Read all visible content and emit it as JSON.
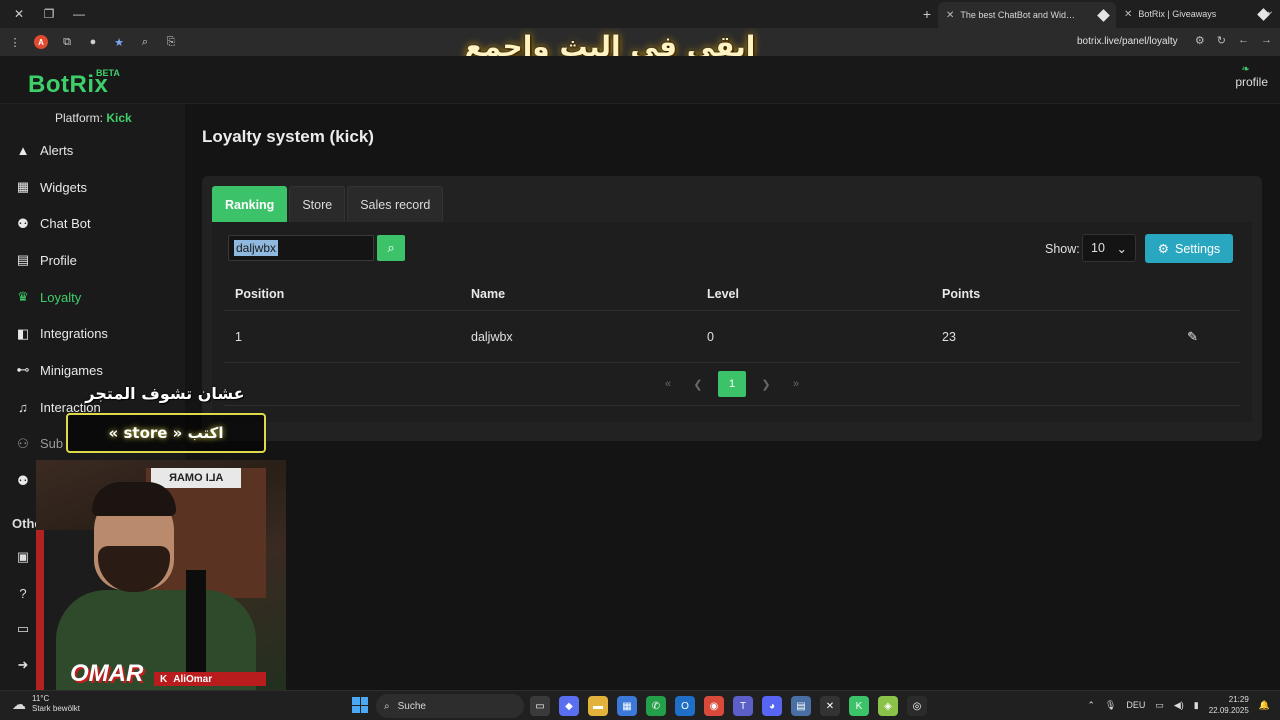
{
  "browser": {
    "tabs": [
      {
        "title": "The best ChatBot and Widgets",
        "active": true
      },
      {
        "title": "BotRix | Giveaways",
        "active": false
      }
    ],
    "url": "botrix.live/panel/loyalty"
  },
  "overlay": {
    "headline": "ابقى في البث واجمع النقاط!",
    "promo_line1": "عشان تشوف المتجر",
    "promo_line2": "اكتب « store »",
    "streamer_name": "OMAR",
    "streamer_tag": "AliOmar",
    "poster_text": "ALI OMAR"
  },
  "app": {
    "logo": "BotRix",
    "beta": "BETA",
    "profile_label": "profile",
    "platform_label": "Platform:",
    "platform_value": "Kick"
  },
  "sidebar": {
    "items": [
      {
        "label": "Alerts",
        "icon": "warning-icon"
      },
      {
        "label": "Widgets",
        "icon": "grid-icon"
      },
      {
        "label": "Chat Bot",
        "icon": "robot-icon"
      },
      {
        "label": "Profile",
        "icon": "id-card-icon"
      },
      {
        "label": "Loyalty",
        "icon": "trophy-icon",
        "active": true
      },
      {
        "label": "Integrations",
        "icon": "puzzle-icon"
      },
      {
        "label": "Minigames",
        "icon": "gamepad-icon"
      },
      {
        "label": "Interaction",
        "icon": "music-icon"
      },
      {
        "label": "Sub",
        "icon": "users-icon"
      }
    ],
    "others_label": "Others"
  },
  "main": {
    "title": "Loyalty system (kick)",
    "tabs": [
      "Ranking",
      "Store",
      "Sales record"
    ],
    "search": {
      "value": "daljwbx"
    },
    "show_label": "Show:",
    "show_value": "10",
    "settings_label": "Settings",
    "table": {
      "headers": [
        "Position",
        "Name",
        "Level",
        "Points"
      ],
      "rows": [
        {
          "position": "1",
          "name": "daljwbx",
          "level": "0",
          "points": "23"
        }
      ]
    },
    "pagination": {
      "current": "1"
    }
  },
  "taskbar": {
    "weather_temp": "11°C",
    "weather_desc": "Stark bewölkt",
    "search_label": "Suche",
    "lang": "DEU",
    "time": "21:29",
    "date": "22.09.2025"
  },
  "colors": {
    "accent_green": "#3cc36a",
    "info_blue": "#2aa7c0"
  }
}
